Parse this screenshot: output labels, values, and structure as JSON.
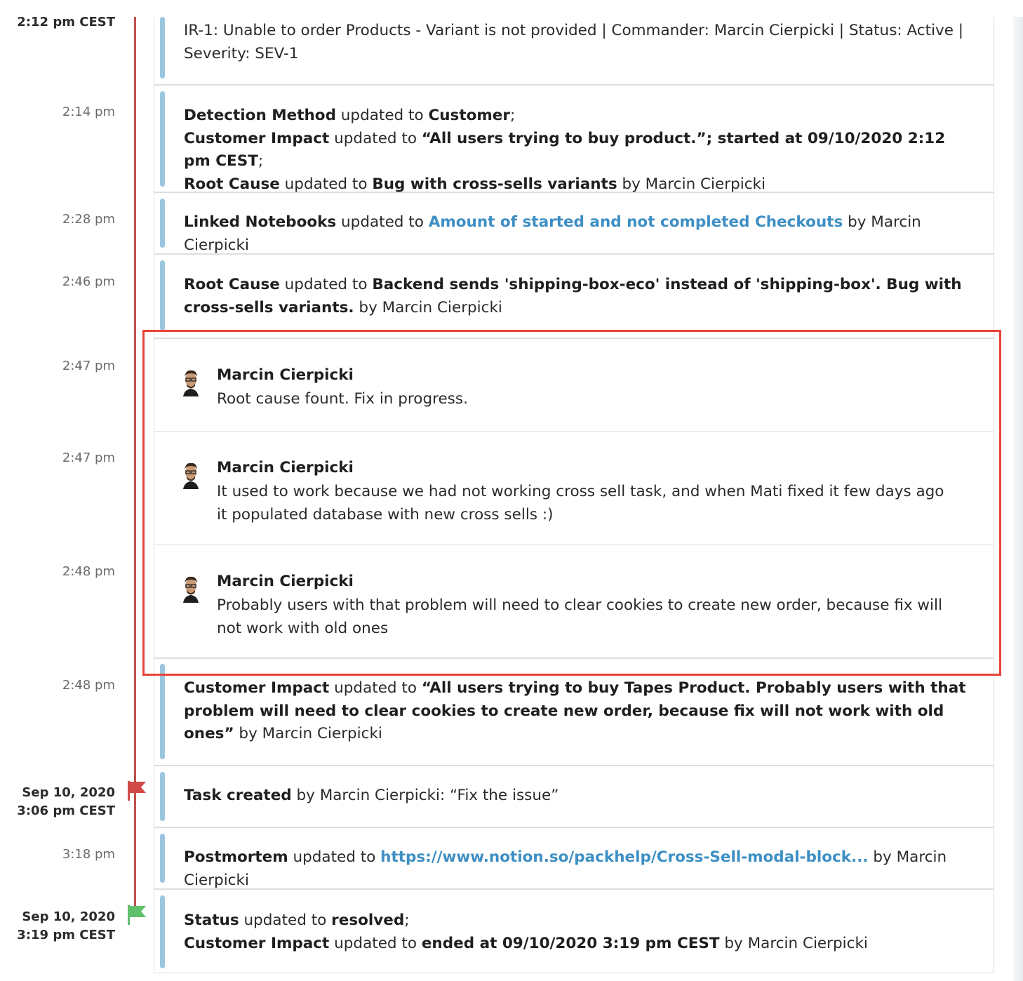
{
  "colors": {
    "timeline_line": "#c0504d",
    "event_bar": "#9cc6df",
    "link": "#3d8fc4",
    "highlight_border": "#e8433a",
    "start_flag": "#d24a47",
    "end_flag": "#5fbf6a"
  },
  "events": [
    {
      "time": "2:12 pm CEST",
      "time_bold": true,
      "parts": [
        {
          "t": "IR-1: Unable to order Products - Variant is not provided | Commander: Marcin Cierpicki | Status: Active | Severity: SEV-1"
        }
      ]
    },
    {
      "time": "2:14 pm",
      "parts": [
        {
          "t": "Detection Method",
          "b": true
        },
        {
          "t": " updated to "
        },
        {
          "t": "Customer",
          "b": true
        },
        {
          "t": ";",
          "br": true
        },
        {
          "t": "Customer Impact",
          "b": true
        },
        {
          "t": " updated to "
        },
        {
          "t": "“All users trying to buy product.”; started at 09/10/2020 2:12 pm CEST",
          "b": true
        },
        {
          "t": ";",
          "br": true
        },
        {
          "t": "Root Cause",
          "b": true
        },
        {
          "t": " updated to "
        },
        {
          "t": "Bug with cross-sells variants",
          "b": true
        },
        {
          "t": " by Marcin Cierpicki"
        }
      ]
    },
    {
      "time": "2:28 pm",
      "parts": [
        {
          "t": "Linked Notebooks",
          "b": true
        },
        {
          "t": " updated to "
        },
        {
          "t": "Amount of started and not completed Checkouts",
          "link": true
        },
        {
          "t": " by Marcin Cierpicki"
        }
      ]
    },
    {
      "time": "2:46 pm",
      "parts": [
        {
          "t": "Root Cause",
          "b": true
        },
        {
          "t": " updated to "
        },
        {
          "t": "Backend sends 'shipping-box-eco' instead of 'shipping-box'. Bug with cross-sells variants.",
          "b": true
        },
        {
          "t": " by Marcin Cierpicki"
        }
      ]
    }
  ],
  "comments": [
    {
      "time": "2:47 pm",
      "author": "Marcin Cierpicki",
      "body": "Root cause fount. Fix in progress."
    },
    {
      "time": "2:47 pm",
      "author": "Marcin Cierpicki",
      "body": "It used to work because we had not working cross sell task, and when Mati fixed it few days ago it populated database with new cross sells :)"
    },
    {
      "time": "2:48 pm",
      "author": "Marcin Cierpicki",
      "body": "Probably users with that problem will need to clear cookies to create new order, because fix will not work with old ones"
    }
  ],
  "events_after": [
    {
      "time": "2:48 pm",
      "parts": [
        {
          "t": "Customer Impact",
          "b": true
        },
        {
          "t": " updated to "
        },
        {
          "t": "“All users trying to buy Tapes Product. Probably users with that problem will need to clear cookies to create new order, because fix will not work with old ones”",
          "b": true
        },
        {
          "t": " by Marcin Cierpicki"
        }
      ]
    },
    {
      "time": "Sep 10, 2020\n3:06 pm CEST",
      "time_bold": true,
      "flag": "start",
      "parts": [
        {
          "t": "Task created",
          "b": true
        },
        {
          "t": " by Marcin Cierpicki: “Fix the issue”"
        }
      ]
    },
    {
      "time": "3:18 pm",
      "parts": [
        {
          "t": "Postmortem",
          "b": true
        },
        {
          "t": " updated to "
        },
        {
          "t": "https://www.notion.so/packhelp/Cross-Sell-modal-block...",
          "link": true
        },
        {
          "t": "  by Marcin Cierpicki"
        }
      ]
    },
    {
      "time": "Sep 10, 2020\n3:19 pm CEST",
      "time_bold": true,
      "flag": "end",
      "parts": [
        {
          "t": "Status",
          "b": true
        },
        {
          "t": " updated to "
        },
        {
          "t": "resolved",
          "b": true
        },
        {
          "t": ";",
          "br": true
        },
        {
          "t": "Customer Impact",
          "b": true
        },
        {
          "t": " updated to "
        },
        {
          "t": "ended at 09/10/2020 3:19 pm CEST",
          "b": true
        },
        {
          "t": " by Marcin Cierpicki"
        }
      ]
    }
  ]
}
